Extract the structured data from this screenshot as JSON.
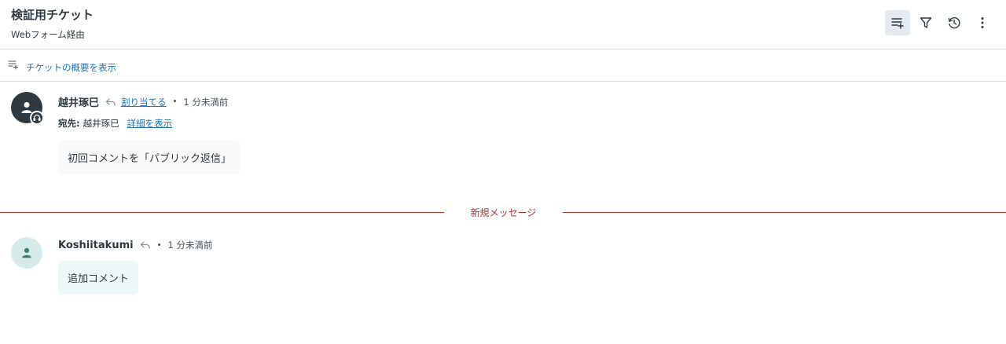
{
  "header": {
    "title": "検証用チケット",
    "subtitle": "Webフォーム経由",
    "toolbar": [
      {
        "icon": "list-add-icon",
        "active": true
      },
      {
        "icon": "filter-icon",
        "active": false
      },
      {
        "icon": "history-icon",
        "active": false
      },
      {
        "icon": "more-vertical-icon",
        "active": false
      }
    ]
  },
  "summary": {
    "link_label": "チケットの概要を表示"
  },
  "comments": [
    {
      "author": "越井琢巳",
      "assign_label": "割り当てる",
      "time": "1 分未満前",
      "recipient_label": "宛先:",
      "recipient": "越井琢巳",
      "details_label": "詳細を表示",
      "body": "初回コメントを「パブリック返信」"
    },
    {
      "author": "Koshiitakumi",
      "time": "1 分未満前",
      "body": "追加コメント"
    }
  ],
  "divider": {
    "label": "新規メッセージ"
  },
  "colors": {
    "accent": "#1f73b7",
    "divider": "#b8322f",
    "text": "#2f3941"
  }
}
